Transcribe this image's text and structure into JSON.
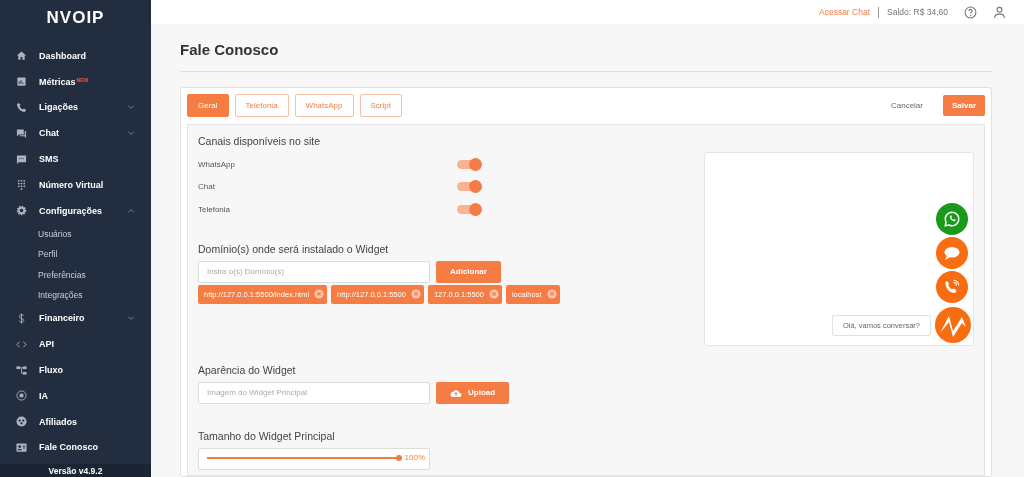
{
  "sidebar": {
    "logo": "NVOIP",
    "items": [
      {
        "label": "Dashboard"
      },
      {
        "label": "Métricas",
        "badge": "NEW"
      },
      {
        "label": "Ligações",
        "expanded": false
      },
      {
        "label": "Chat",
        "expanded": false
      },
      {
        "label": "SMS"
      },
      {
        "label": "Número Virtual"
      },
      {
        "label": "Configurações",
        "expanded": true,
        "children": [
          {
            "label": "Usuários"
          },
          {
            "label": "Perfil"
          },
          {
            "label": "Preferências"
          },
          {
            "label": "Integrações"
          }
        ]
      },
      {
        "label": "Financeiro",
        "expanded": false
      },
      {
        "label": "API"
      },
      {
        "label": "Fluxo"
      },
      {
        "label": "IA"
      },
      {
        "label": "Afiliados"
      },
      {
        "label": "Fale Conosco"
      }
    ],
    "version": "Versão v4.9.2"
  },
  "header": {
    "chat_link": "Acessar Chat",
    "balance": "Saldo: R$ 34,60"
  },
  "page_title": "Fale Conosco",
  "tabs": [
    {
      "label": "Geral",
      "selected": true
    },
    {
      "label": "Telefonia",
      "selected": false
    },
    {
      "label": "WhatsApp",
      "selected": false
    },
    {
      "label": "Script",
      "selected": false
    }
  ],
  "actions": {
    "cancel": "Cancelar",
    "save": "Salvar"
  },
  "channels": {
    "title": "Canais disponíveis no site",
    "items": [
      {
        "label": "WhatsApp",
        "on": true
      },
      {
        "label": "Chat",
        "on": true
      },
      {
        "label": "Telefonia",
        "on": true
      }
    ]
  },
  "domains": {
    "title": "Domínio(s) onde será instalado o Widget",
    "placeholder": "Insira o(s) Domínio(s)",
    "button": "Adicionar",
    "tags": [
      "http://127.0.0.1:5500/index.html",
      "http://127.0.0.1:5500",
      "127.0.0.1:5500",
      "localhost"
    ]
  },
  "appearance": {
    "title": "Aparência do Widget",
    "placeholder": "Imagem do Widget Principal",
    "button": "Upload"
  },
  "size": {
    "title": "Tamanho do Widget Principal",
    "level": 1.0,
    "reading": "100%"
  },
  "preview": {
    "greeting": "Olá, vamos conversar?",
    "buttons": [
      {
        "kind": "whatsapp"
      },
      {
        "kind": "chat"
      },
      {
        "kind": "phone"
      }
    ]
  }
}
